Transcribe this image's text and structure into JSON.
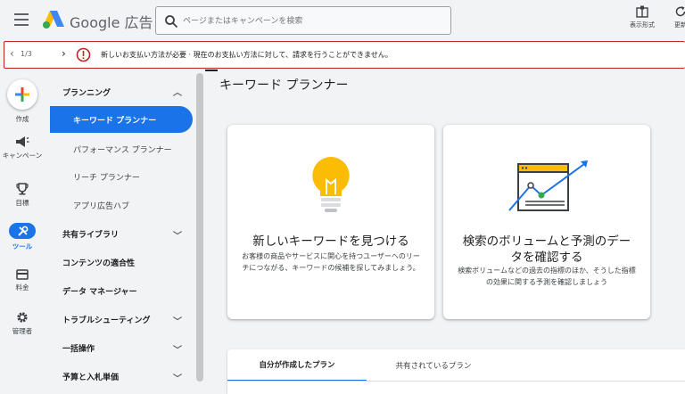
{
  "header": {
    "brand": "Google 広告",
    "search_placeholder": "ページまたはキャンペーンを検索",
    "tools": [
      {
        "label": "表示形式",
        "icon": "view-format-icon"
      },
      {
        "label": "更新",
        "icon": "refresh-icon"
      }
    ]
  },
  "alert": {
    "pager": "1/3",
    "message": "新しいお支払い方法が必要 · 現在のお支払い方法に対して、請求を行うことができません。",
    "color": "#c5221f"
  },
  "rail": [
    {
      "label": "作成",
      "icon": "plus-icon"
    },
    {
      "label": "キャンペーン",
      "icon": "megaphone-icon"
    },
    {
      "label": "目標",
      "icon": "trophy-icon"
    },
    {
      "label": "ツール",
      "icon": "tools-icon",
      "active": true
    },
    {
      "label": "料金",
      "icon": "card-icon"
    },
    {
      "label": "管理者",
      "icon": "gear-icon"
    }
  ],
  "nav": {
    "section": "プランニング",
    "items": [
      {
        "label": "キーワード プランナー",
        "active": true
      },
      {
        "label": "パフォーマンス プランナー"
      },
      {
        "label": "リーチ プランナー"
      },
      {
        "label": "アプリ広告ハブ"
      }
    ],
    "groups": [
      {
        "label": "共有ライブラリ",
        "expandable": true
      },
      {
        "label": "コンテンツの適合性",
        "expandable": false
      },
      {
        "label": "データ マネージャー",
        "expandable": false
      },
      {
        "label": "トラブルシューティング",
        "expandable": true
      },
      {
        "label": "一括操作",
        "expandable": true
      },
      {
        "label": "予算と入札単価",
        "expandable": true
      }
    ]
  },
  "main": {
    "title": "キーワード プランナー",
    "cards": [
      {
        "title": "新しいキーワードを見つける",
        "desc": "お客様の商品やサービスに関心を持つユーザーへのリーチにつながる、キーワードの候補を探してみましょう。",
        "icon": "lightbulb-icon"
      },
      {
        "title": "検索のボリュームと予測のデータを確認する",
        "desc": "検索ボリュームなどの過去の指標のほか、そうした指標の効果に関する予測を確認しましょう",
        "icon": "trend-chart-icon"
      }
    ],
    "tabs": [
      {
        "label": "自分が作成したプラン",
        "selected": true
      },
      {
        "label": "共有されているプラン",
        "selected": false
      }
    ]
  },
  "colors": {
    "accent": "#1a73e8",
    "error": "#c5221f",
    "bulb": "#fbbc04"
  }
}
